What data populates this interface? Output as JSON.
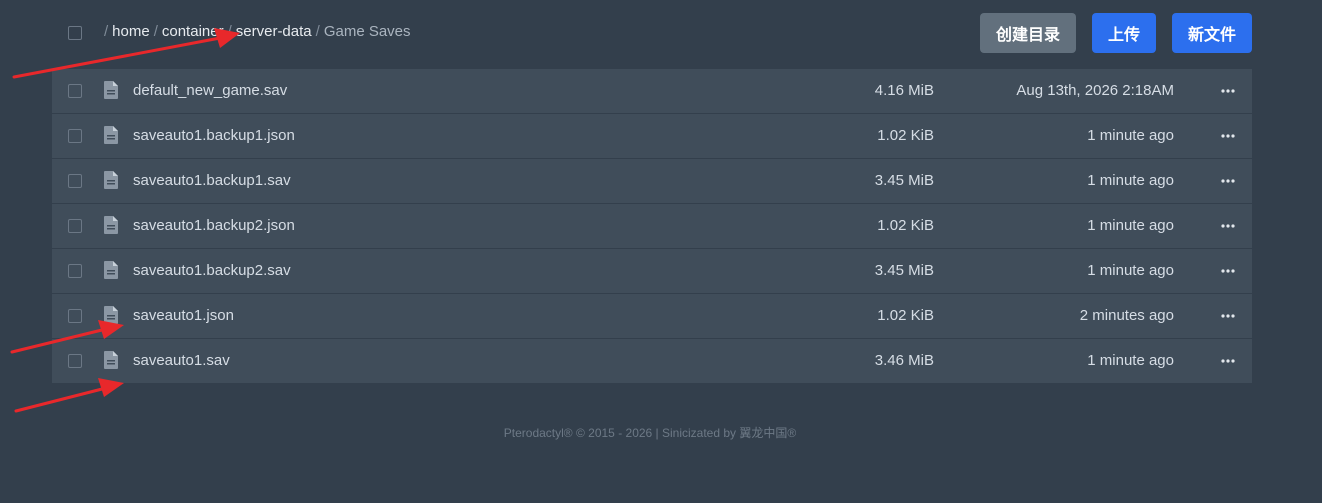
{
  "breadcrumb": {
    "home": "home",
    "container": "container",
    "server_data": "server-data",
    "current": "Game Saves",
    "separator": "/"
  },
  "toolbar": {
    "create_dir_label": "创建目录",
    "upload_label": "上传",
    "new_file_label": "新文件"
  },
  "files": [
    {
      "name": "default_new_game.sav",
      "size": "4.16 MiB",
      "modified": "Aug 13th, 2026 2:18AM"
    },
    {
      "name": "saveauto1.backup1.json",
      "size": "1.02 KiB",
      "modified": "1 minute ago"
    },
    {
      "name": "saveauto1.backup1.sav",
      "size": "3.45 MiB",
      "modified": "1 minute ago"
    },
    {
      "name": "saveauto1.backup2.json",
      "size": "1.02 KiB",
      "modified": "1 minute ago"
    },
    {
      "name": "saveauto1.backup2.sav",
      "size": "3.45 MiB",
      "modified": "1 minute ago"
    },
    {
      "name": "saveauto1.json",
      "size": "1.02 KiB",
      "modified": "2 minutes ago"
    },
    {
      "name": "saveauto1.sav",
      "size": "3.46 MiB",
      "modified": "1 minute ago"
    }
  ],
  "footer": {
    "text": "Pterodactyl® © 2015 - 2026 | Sinicizated by 翼龙中国®"
  },
  "colors": {
    "background": "#333f4c",
    "row": "#404d5a",
    "primary_button": "#2c6fee",
    "secondary_button": "#62707d",
    "annotation_arrow": "#e8282b"
  },
  "icons": {
    "file": "file-text-icon",
    "menu": "more-horizontal-icon",
    "annotation": "red-arrow-annotation"
  }
}
